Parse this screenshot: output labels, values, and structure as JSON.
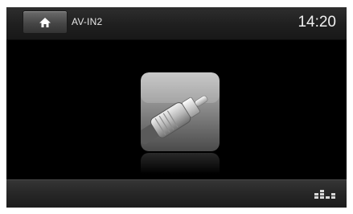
{
  "header": {
    "source_title": "AV-IN2",
    "time": "14:20",
    "home_icon": "home-icon"
  },
  "main": {
    "source_icon": "av-cable-icon"
  },
  "footer": {
    "equalizer_icon": "equalizer-icon"
  },
  "colors": {
    "screen_background": "#000000",
    "bar_background": "#262626",
    "text": "#f0f0f0"
  }
}
